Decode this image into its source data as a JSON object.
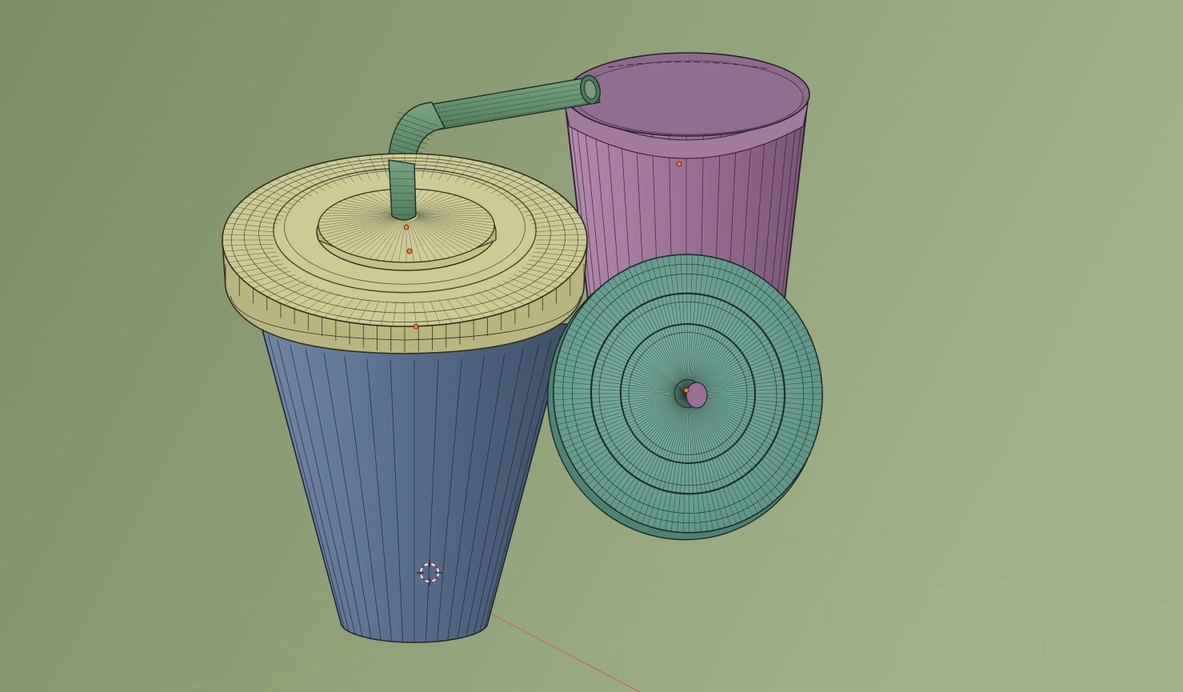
{
  "viewport": {
    "background": "#8a9a70",
    "background_light": "#a0b088",
    "grid_color": "#9aaa84",
    "axis_x_color": "#c86a5a",
    "axis_y_color": "#8fb05a"
  },
  "objects": [
    {
      "name": "cup-blue",
      "color": "#5a7190",
      "wire": "#1c2230"
    },
    {
      "name": "lid-yellow",
      "color": "#c4c38c",
      "wire": "#2e2e1e"
    },
    {
      "name": "straw-green",
      "color": "#5f8f6a",
      "wire": "#1d2e20"
    },
    {
      "name": "cup-pink",
      "color": "#9a6e96",
      "wire": "#2e1e2c"
    },
    {
      "name": "lid-teal",
      "color": "#6fa596",
      "wire": "#1a2e28"
    }
  ],
  "markers": {
    "origin_color": "#ff7a1a",
    "cursor_color": "#ffffff",
    "cursor_accent": "#c0202a"
  }
}
